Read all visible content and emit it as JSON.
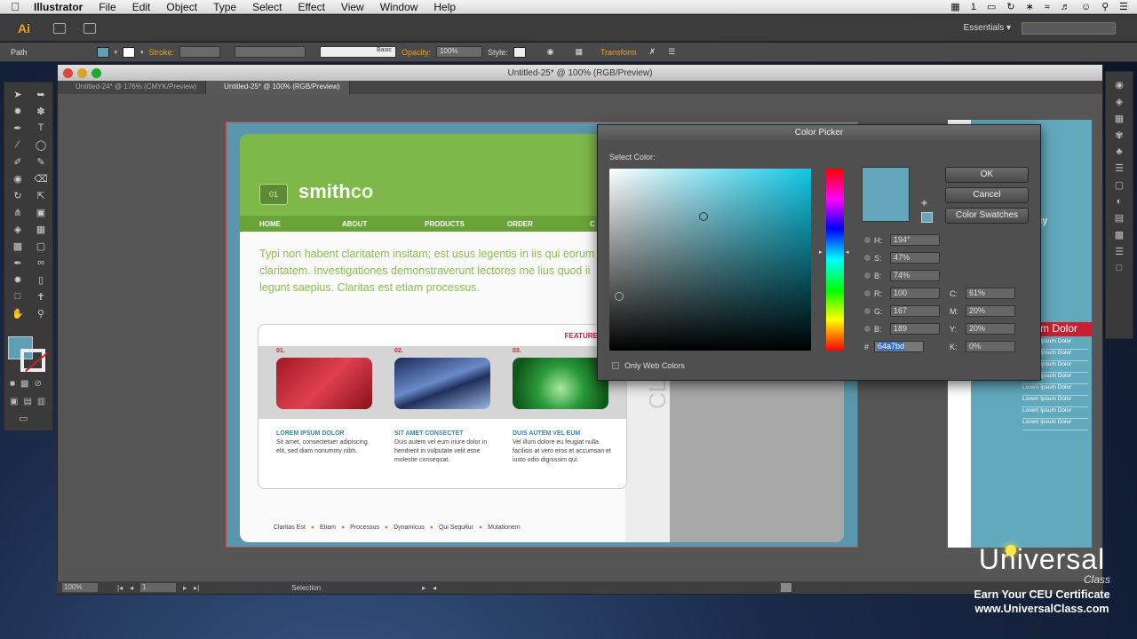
{
  "menubar": {
    "app": "Illustrator",
    "items": [
      "File",
      "Edit",
      "Object",
      "Type",
      "Select",
      "Effect",
      "View",
      "Window",
      "Help"
    ],
    "status_counter": "1"
  },
  "appbar": {
    "logo": "Ai",
    "workspace": "Essentials ▾"
  },
  "controlbar": {
    "selection_type": "Path",
    "stroke_label": "Stroke:",
    "brush_label": "Basic",
    "opacity_label": "Opacity:",
    "opacity_value": "100%",
    "style_label": "Style:",
    "transform_label": "Transform",
    "fill_color": "#5e9fb5"
  },
  "document": {
    "window_title": "Untitled-25* @ 100% (RGB/Preview)",
    "tabs": [
      {
        "label": "Untitled-24* @ 176% (CMYK/Preview)",
        "active": false
      },
      {
        "label": "Untitled-25* @ 100% (RGB/Preview)",
        "active": true
      }
    ]
  },
  "webpage": {
    "logo_number": "01",
    "logo_text": "smith",
    "logo_suffix": "co",
    "nav": [
      "HOME",
      "ABOUT",
      "PRODUCTS",
      "ORDER",
      "C"
    ],
    "intro": "Typi non habent claritatem insitam; est usus legentis in iis qui eorum claritatem. Investigationes demonstraverunt lectores me lius quod ii legunt saepius. Claritas est etiam processus.",
    "featured_title": "FEATURED ART",
    "items": [
      {
        "num": "01.",
        "heading": "LOREM IPSUM DOLOR",
        "text": "Sit amet, consectetuer adipiscing elit, sed diam nonummy nibh."
      },
      {
        "num": "02.",
        "heading": "SIT AMET CONSECTET",
        "text": "Duis autem vel eum iriure dolor in hendrerit in vulputate velit esse molestie consequat."
      },
      {
        "num": "03.",
        "heading": "DUIS AUTEM VEL EUM",
        "text": "Vel illum dolore eu feugiat nulla facilisis at vero eros et accumsan et iusto odio dignissim qui."
      }
    ],
    "footer": [
      "Claritas Est",
      "Etiam",
      "Processus",
      "Dynamicus",
      "Qui Sequitur",
      "Mutationem"
    ],
    "side_text": "CLA"
  },
  "brochure": {
    "company": "npany",
    "banner": "m Dolor",
    "list": [
      "Lorem Ipsum Dolor",
      "Lorem Ipsum Dolor",
      "Lorem Ipsum Dolor",
      "Lorem Ipsum Dolor",
      "Lorem Ipsum Dolor",
      "Lorem Ipsum Dolor",
      "Lorem Ipsum Dolor",
      "Lorem Ipsum Dolor"
    ]
  },
  "picker": {
    "title": "Color Picker",
    "select_label": "Select Color:",
    "ok": "OK",
    "cancel": "Cancel",
    "swatches": "Color Swatches",
    "only_web": "Only Web Colors",
    "current_color": "#64a7bd",
    "hsb": [
      {
        "key": "H:",
        "value": "194°"
      },
      {
        "key": "S:",
        "value": "47%"
      },
      {
        "key": "B:",
        "value": "74%"
      }
    ],
    "rgb": [
      {
        "key": "R:",
        "value": "100"
      },
      {
        "key": "G:",
        "value": "167"
      },
      {
        "key": "B:",
        "value": "189"
      }
    ],
    "cmyk": [
      {
        "key": "C:",
        "value": "61%"
      },
      {
        "key": "M:",
        "value": "20%"
      },
      {
        "key": "Y:",
        "value": "20%"
      },
      {
        "key": "K:",
        "value": "0%"
      }
    ],
    "hex_label": "#",
    "hex_value": "64a7bd"
  },
  "statusbar": {
    "zoom": "100%",
    "artboard": "1",
    "tool": "Selection"
  },
  "watermark": {
    "brand": "Universal",
    "sub": "Class",
    "line1": "Earn Your CEU Certificate",
    "line2": "www.UniversalClass.com"
  }
}
